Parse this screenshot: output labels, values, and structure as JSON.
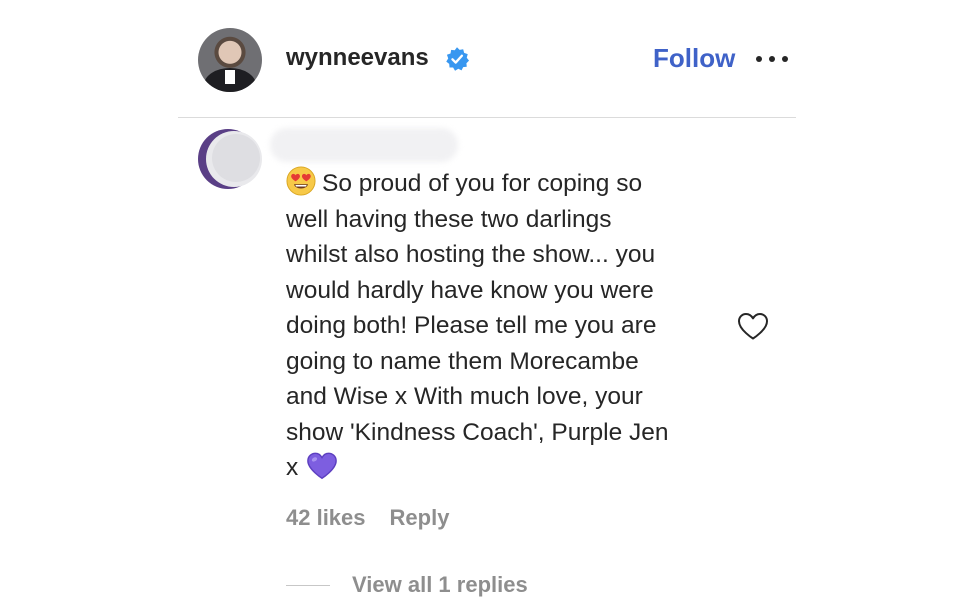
{
  "post_header": {
    "username": "wynneevans",
    "follow_label": "Follow",
    "more_icon": "more-horizontal-icon",
    "verified_icon": "verified-badge-icon",
    "colors": {
      "follow": "#3f62c8",
      "verified": "#3897f0"
    }
  },
  "comment": {
    "leading_emoji": "smiling-face-with-heart-eyes-icon",
    "lines": [
      "So proud of you for coping so",
      "well having these two darlings",
      "whilst also hosting the show... you",
      "would hardly have know you were",
      "doing both! Please tell me you are",
      "going to name them Morecambe",
      "and Wise x With much love, your",
      "show 'Kindness Coach', Purple Jen",
      "x"
    ],
    "trailing_emoji": "purple-heart-icon",
    "likes": "42 likes",
    "reply_label": "Reply",
    "like_icon": "heart-outline-icon",
    "view_replies_label": "View all 1 replies",
    "colors": {
      "heart": "#7d5ee0"
    }
  }
}
